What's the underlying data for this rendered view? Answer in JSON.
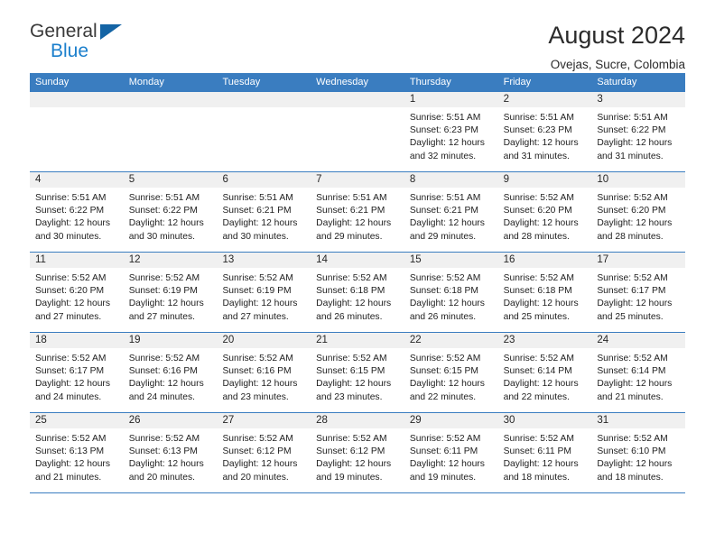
{
  "brand": {
    "name_top": "General",
    "name_bottom": "Blue",
    "triangle_color": "#1464a5",
    "blue_color": "#1b7fcc"
  },
  "header": {
    "title": "August 2024",
    "subtitle": "Ovejas, Sucre, Colombia"
  },
  "theme": {
    "header_blue": "#3a7dc0",
    "day_band": "#f0f0f0",
    "text": "#1e1e1e"
  },
  "weekdays": [
    "Sunday",
    "Monday",
    "Tuesday",
    "Wednesday",
    "Thursday",
    "Friday",
    "Saturday"
  ],
  "weeks": [
    [
      {
        "date": "",
        "empty": true,
        "sunrise": "",
        "sunset": "",
        "daylight_line1": "",
        "daylight_line2": ""
      },
      {
        "date": "",
        "empty": true,
        "sunrise": "",
        "sunset": "",
        "daylight_line1": "",
        "daylight_line2": ""
      },
      {
        "date": "",
        "empty": true,
        "sunrise": "",
        "sunset": "",
        "daylight_line1": "",
        "daylight_line2": ""
      },
      {
        "date": "",
        "empty": true,
        "sunrise": "",
        "sunset": "",
        "daylight_line1": "",
        "daylight_line2": ""
      },
      {
        "date": "1",
        "sunrise": "Sunrise: 5:51 AM",
        "sunset": "Sunset: 6:23 PM",
        "daylight_line1": "Daylight: 12 hours",
        "daylight_line2": "and 32 minutes."
      },
      {
        "date": "2",
        "sunrise": "Sunrise: 5:51 AM",
        "sunset": "Sunset: 6:23 PM",
        "daylight_line1": "Daylight: 12 hours",
        "daylight_line2": "and 31 minutes."
      },
      {
        "date": "3",
        "sunrise": "Sunrise: 5:51 AM",
        "sunset": "Sunset: 6:22 PM",
        "daylight_line1": "Daylight: 12 hours",
        "daylight_line2": "and 31 minutes."
      }
    ],
    [
      {
        "date": "4",
        "sunrise": "Sunrise: 5:51 AM",
        "sunset": "Sunset: 6:22 PM",
        "daylight_line1": "Daylight: 12 hours",
        "daylight_line2": "and 30 minutes."
      },
      {
        "date": "5",
        "sunrise": "Sunrise: 5:51 AM",
        "sunset": "Sunset: 6:22 PM",
        "daylight_line1": "Daylight: 12 hours",
        "daylight_line2": "and 30 minutes."
      },
      {
        "date": "6",
        "sunrise": "Sunrise: 5:51 AM",
        "sunset": "Sunset: 6:21 PM",
        "daylight_line1": "Daylight: 12 hours",
        "daylight_line2": "and 30 minutes."
      },
      {
        "date": "7",
        "sunrise": "Sunrise: 5:51 AM",
        "sunset": "Sunset: 6:21 PM",
        "daylight_line1": "Daylight: 12 hours",
        "daylight_line2": "and 29 minutes."
      },
      {
        "date": "8",
        "sunrise": "Sunrise: 5:51 AM",
        "sunset": "Sunset: 6:21 PM",
        "daylight_line1": "Daylight: 12 hours",
        "daylight_line2": "and 29 minutes."
      },
      {
        "date": "9",
        "sunrise": "Sunrise: 5:52 AM",
        "sunset": "Sunset: 6:20 PM",
        "daylight_line1": "Daylight: 12 hours",
        "daylight_line2": "and 28 minutes."
      },
      {
        "date": "10",
        "sunrise": "Sunrise: 5:52 AM",
        "sunset": "Sunset: 6:20 PM",
        "daylight_line1": "Daylight: 12 hours",
        "daylight_line2": "and 28 minutes."
      }
    ],
    [
      {
        "date": "11",
        "sunrise": "Sunrise: 5:52 AM",
        "sunset": "Sunset: 6:20 PM",
        "daylight_line1": "Daylight: 12 hours",
        "daylight_line2": "and 27 minutes."
      },
      {
        "date": "12",
        "sunrise": "Sunrise: 5:52 AM",
        "sunset": "Sunset: 6:19 PM",
        "daylight_line1": "Daylight: 12 hours",
        "daylight_line2": "and 27 minutes."
      },
      {
        "date": "13",
        "sunrise": "Sunrise: 5:52 AM",
        "sunset": "Sunset: 6:19 PM",
        "daylight_line1": "Daylight: 12 hours",
        "daylight_line2": "and 27 minutes."
      },
      {
        "date": "14",
        "sunrise": "Sunrise: 5:52 AM",
        "sunset": "Sunset: 6:18 PM",
        "daylight_line1": "Daylight: 12 hours",
        "daylight_line2": "and 26 minutes."
      },
      {
        "date": "15",
        "sunrise": "Sunrise: 5:52 AM",
        "sunset": "Sunset: 6:18 PM",
        "daylight_line1": "Daylight: 12 hours",
        "daylight_line2": "and 26 minutes."
      },
      {
        "date": "16",
        "sunrise": "Sunrise: 5:52 AM",
        "sunset": "Sunset: 6:18 PM",
        "daylight_line1": "Daylight: 12 hours",
        "daylight_line2": "and 25 minutes."
      },
      {
        "date": "17",
        "sunrise": "Sunrise: 5:52 AM",
        "sunset": "Sunset: 6:17 PM",
        "daylight_line1": "Daylight: 12 hours",
        "daylight_line2": "and 25 minutes."
      }
    ],
    [
      {
        "date": "18",
        "sunrise": "Sunrise: 5:52 AM",
        "sunset": "Sunset: 6:17 PM",
        "daylight_line1": "Daylight: 12 hours",
        "daylight_line2": "and 24 minutes."
      },
      {
        "date": "19",
        "sunrise": "Sunrise: 5:52 AM",
        "sunset": "Sunset: 6:16 PM",
        "daylight_line1": "Daylight: 12 hours",
        "daylight_line2": "and 24 minutes."
      },
      {
        "date": "20",
        "sunrise": "Sunrise: 5:52 AM",
        "sunset": "Sunset: 6:16 PM",
        "daylight_line1": "Daylight: 12 hours",
        "daylight_line2": "and 23 minutes."
      },
      {
        "date": "21",
        "sunrise": "Sunrise: 5:52 AM",
        "sunset": "Sunset: 6:15 PM",
        "daylight_line1": "Daylight: 12 hours",
        "daylight_line2": "and 23 minutes."
      },
      {
        "date": "22",
        "sunrise": "Sunrise: 5:52 AM",
        "sunset": "Sunset: 6:15 PM",
        "daylight_line1": "Daylight: 12 hours",
        "daylight_line2": "and 22 minutes."
      },
      {
        "date": "23",
        "sunrise": "Sunrise: 5:52 AM",
        "sunset": "Sunset: 6:14 PM",
        "daylight_line1": "Daylight: 12 hours",
        "daylight_line2": "and 22 minutes."
      },
      {
        "date": "24",
        "sunrise": "Sunrise: 5:52 AM",
        "sunset": "Sunset: 6:14 PM",
        "daylight_line1": "Daylight: 12 hours",
        "daylight_line2": "and 21 minutes."
      }
    ],
    [
      {
        "date": "25",
        "sunrise": "Sunrise: 5:52 AM",
        "sunset": "Sunset: 6:13 PM",
        "daylight_line1": "Daylight: 12 hours",
        "daylight_line2": "and 21 minutes."
      },
      {
        "date": "26",
        "sunrise": "Sunrise: 5:52 AM",
        "sunset": "Sunset: 6:13 PM",
        "daylight_line1": "Daylight: 12 hours",
        "daylight_line2": "and 20 minutes."
      },
      {
        "date": "27",
        "sunrise": "Sunrise: 5:52 AM",
        "sunset": "Sunset: 6:12 PM",
        "daylight_line1": "Daylight: 12 hours",
        "daylight_line2": "and 20 minutes."
      },
      {
        "date": "28",
        "sunrise": "Sunrise: 5:52 AM",
        "sunset": "Sunset: 6:12 PM",
        "daylight_line1": "Daylight: 12 hours",
        "daylight_line2": "and 19 minutes."
      },
      {
        "date": "29",
        "sunrise": "Sunrise: 5:52 AM",
        "sunset": "Sunset: 6:11 PM",
        "daylight_line1": "Daylight: 12 hours",
        "daylight_line2": "and 19 minutes."
      },
      {
        "date": "30",
        "sunrise": "Sunrise: 5:52 AM",
        "sunset": "Sunset: 6:11 PM",
        "daylight_line1": "Daylight: 12 hours",
        "daylight_line2": "and 18 minutes."
      },
      {
        "date": "31",
        "sunrise": "Sunrise: 5:52 AM",
        "sunset": "Sunset: 6:10 PM",
        "daylight_line1": "Daylight: 12 hours",
        "daylight_line2": "and 18 minutes."
      }
    ]
  ]
}
